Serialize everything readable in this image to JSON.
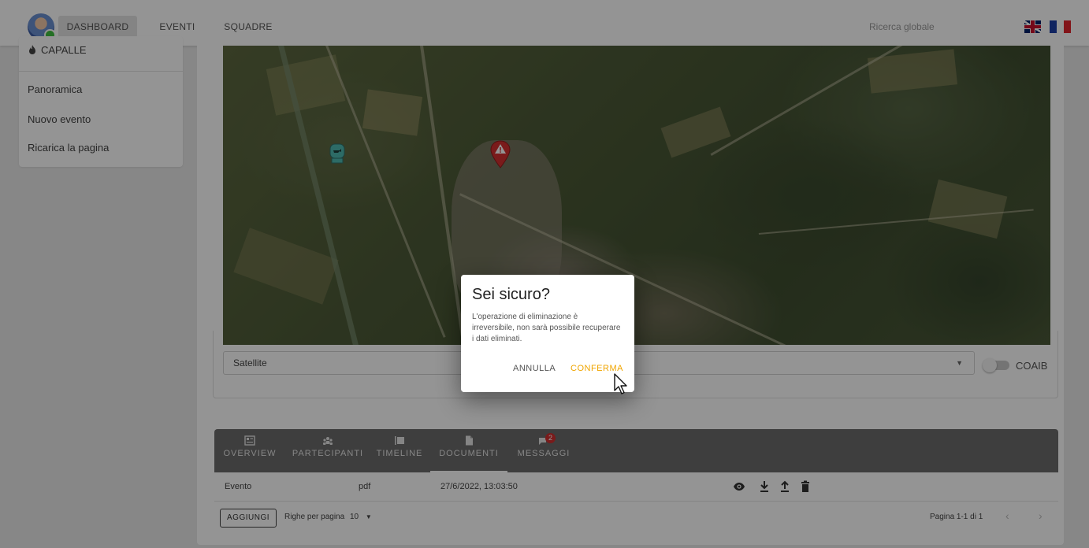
{
  "topbar": {
    "nav": [
      "DASHBOARD",
      "EVENTI",
      "SQUADRE"
    ],
    "search_placeholder": "Ricerca globale",
    "flags": [
      "flag-uk-icon",
      "flag-fr-icon"
    ]
  },
  "sidebar": {
    "event_name": "CAPALLE",
    "links": [
      "Panoramica",
      "Nuovo evento",
      "Ricarica la pagina"
    ]
  },
  "map": {
    "layer_value": "Satellite",
    "toggle_label": "COAIB",
    "toggle_on": false,
    "markers": [
      "poi-marker-icon",
      "alert-marker-icon"
    ]
  },
  "tabs": [
    {
      "label": "OVERVIEW",
      "icon": "overview-icon"
    },
    {
      "label": "PARTECIPANTI",
      "icon": "people-icon"
    },
    {
      "label": "TIMELINE",
      "icon": "timeline-icon"
    },
    {
      "label": "DOCUMENTI",
      "icon": "document-icon",
      "active": true
    },
    {
      "label": "MESSAGGI",
      "icon": "messages-icon",
      "badge": "2"
    }
  ],
  "documents": {
    "rows": [
      {
        "name": "Evento",
        "type": "pdf",
        "date": "27/6/2022, 13:03:50"
      }
    ],
    "actions": [
      "view-icon",
      "download-icon",
      "upload-icon",
      "delete-icon"
    ],
    "add_label": "AGGIUNGI",
    "rows_per_page_label": "Righe per pagina",
    "rows_per_page_value": "10",
    "pagination": "Pagina 1-1 di 1"
  },
  "dialog": {
    "title": "Sei sicuro?",
    "message": "L'operazione di eliminazione è irreversibile, non sarà possibile recuperare i dati eliminati.",
    "cancel_label": "ANNULLA",
    "confirm_label": "CONFERMA"
  },
  "colors": {
    "confirm": "#f0a500",
    "alert_marker": "#d32f2f",
    "poi_marker": "#4fb8b0",
    "tabbar": "#6b6b6b",
    "badge": "#d32f2f"
  }
}
